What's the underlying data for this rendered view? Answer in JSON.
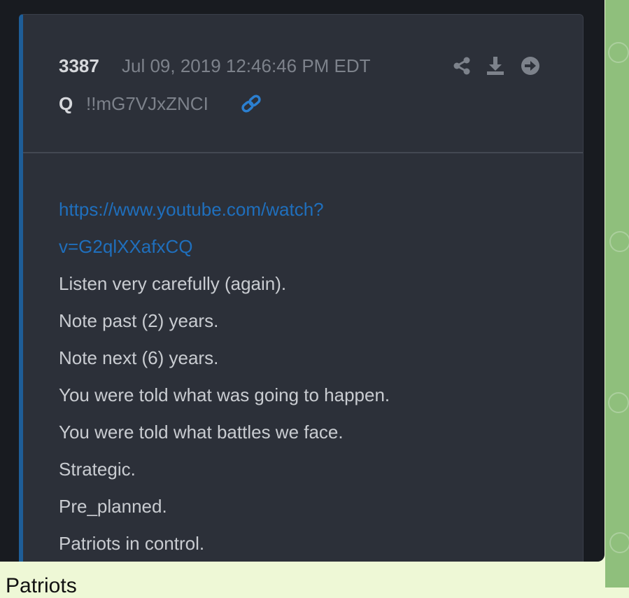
{
  "post": {
    "number": "3387",
    "date": "Jul 09, 2019 12:46:46 PM EDT",
    "author": "Q",
    "tripcode": "!!mG7VJxZNCI",
    "link_line1": "https://www.youtube.com/watch?",
    "link_line2": "v=G2qlXXafxCQ",
    "lines": [
      "Listen very carefully (again).",
      "Note past (2) years.",
      "Note next (6) years.",
      "You were told what was going to happen.",
      "You were told what battles we face.",
      "Strategic.",
      "Pre_planned.",
      "Patriots in control."
    ]
  },
  "caption": {
    "text": "Patriots"
  },
  "icons": {
    "share": "share-icon",
    "download": "download-icon",
    "next": "arrow-circle-right-icon",
    "link": "link-icon"
  },
  "colors": {
    "accent_bar": "#1e5d97",
    "link": "#1f6fbd",
    "card_bg": "#2c3039",
    "chat_bg": "#8fbf7c"
  }
}
